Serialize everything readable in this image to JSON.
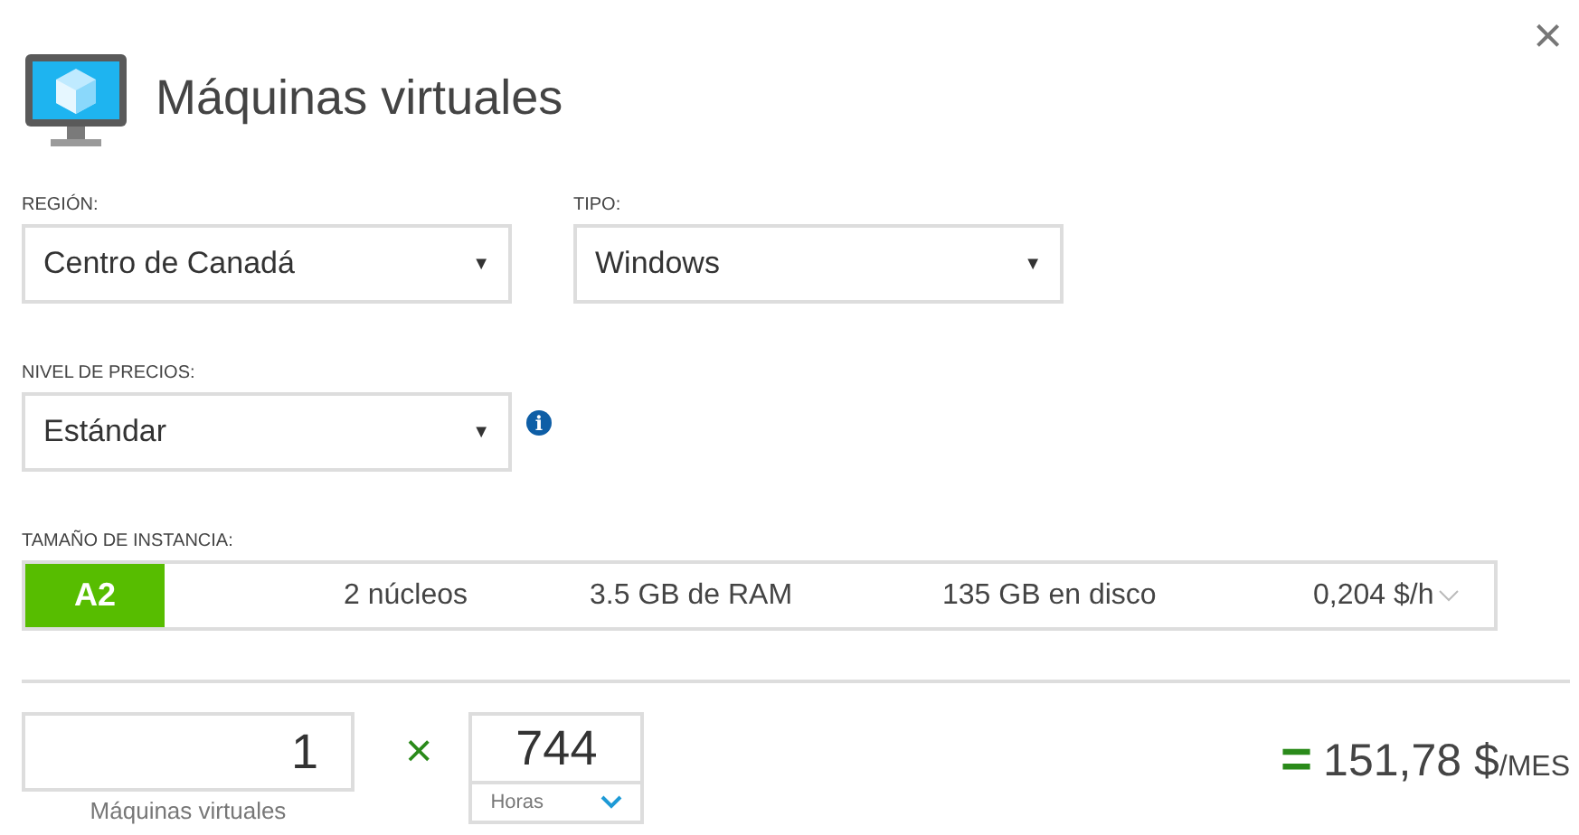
{
  "title": "Máquinas virtuales",
  "close": "×",
  "fields": [
    {
      "label": "REGIÓN:",
      "value": "Centro de Canadá",
      "arrow": "▼"
    },
    {
      "label": "TIPO:",
      "value": "Windows",
      "arrow": "▼"
    }
  ],
  "pricing": {
    "label": "NIVEL DE PRECIOS:",
    "value": "Estándar",
    "arrow": "▼",
    "info": "i"
  },
  "instance": {
    "label": "TAMAÑO DE INSTANCIA:",
    "size": "A2",
    "cores": "2 núcleos",
    "ram": "3.5 GB de RAM",
    "disk": "135 GB en disco",
    "price": "0,204 $/h"
  },
  "quantity": {
    "value": "1",
    "label": "Máquinas virtuales"
  },
  "times": "×",
  "hours": {
    "value": "744",
    "unit": "Horas"
  },
  "total": {
    "equals": "=",
    "amount": "151,78 $",
    "per": "/MES"
  }
}
